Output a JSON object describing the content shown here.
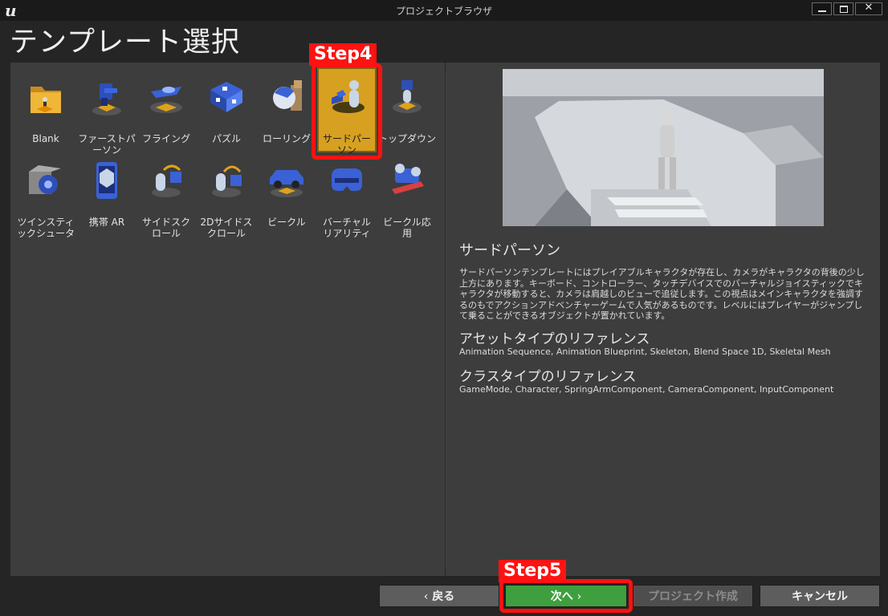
{
  "window": {
    "title": "プロジェクトブラウザ",
    "logo": "unreal-engine-logo"
  },
  "page_title": "テンプレート選択",
  "templates": [
    {
      "label": "Blank",
      "icon": "folder-icon"
    },
    {
      "label": "ファーストパ\nーソン",
      "icon": "first-person-gun-icon"
    },
    {
      "label": "フライング",
      "icon": "flying-ship-icon"
    },
    {
      "label": "パズル",
      "icon": "puzzle-blocks-icon"
    },
    {
      "label": "ローリング",
      "icon": "rolling-ball-icon"
    },
    {
      "label": "サードパー\nソン",
      "icon": "third-person-character-icon"
    },
    {
      "label": "トップダウン",
      "icon": "top-down-character-icon"
    },
    {
      "label": "ツインスティ\nックシュータ",
      "icon": "twin-stick-ship-icon"
    },
    {
      "label": "携帯 AR",
      "icon": "mobile-phone-ar-icon"
    },
    {
      "label": "サイドスク\nロール",
      "icon": "side-scroller-icon"
    },
    {
      "label": "2Dサイドス\nクロール",
      "icon": "side-scroller-2d-icon"
    },
    {
      "label": "ビークル",
      "icon": "vehicle-car-icon"
    },
    {
      "label": "バーチャル\nリアリティ",
      "icon": "vr-headset-icon"
    },
    {
      "label": "ビークル応\n用",
      "icon": "vehicle-advanced-icon"
    }
  ],
  "selected_template": "サードパーソン",
  "annotations": {
    "step4": "Step4",
    "step5": "Step5"
  },
  "details": {
    "name": "サードパーソン",
    "description": "サードパーソンテンプレートにはプレイアブルキャラクタが存在し、カメラがキャラクタの背後の少し上方にあります。キーボード、コントローラー、タッチデバイスでのバーチャルジョイスティックでキャラクタが移動すると、カメラは肩越しのビューで追従します。この視点はメインキャラクタを強調するのもでアクションアドベンチャーゲームで人気があるものです。レベルにはプレイヤーがジャンプして乗ることができるオブジェクトが置かれています。",
    "asset_heading": "アセットタイプのリファレンス",
    "asset_types": "Animation Sequence, Animation Blueprint, Skeleton, Blend Space 1D, Skeletal Mesh",
    "class_heading": "クラスタイプのリファレンス",
    "class_types": "GameMode, Character, SpringArmComponent, CameraComponent, InputComponent"
  },
  "buttons": {
    "back": "戻る",
    "next": "次へ",
    "create": "プロジェクト作成",
    "cancel": "キャンセル"
  },
  "colors": {
    "selected_tile": "#d7a020",
    "next_button": "#3f9f3f",
    "annotation_red": "#ff1212"
  }
}
